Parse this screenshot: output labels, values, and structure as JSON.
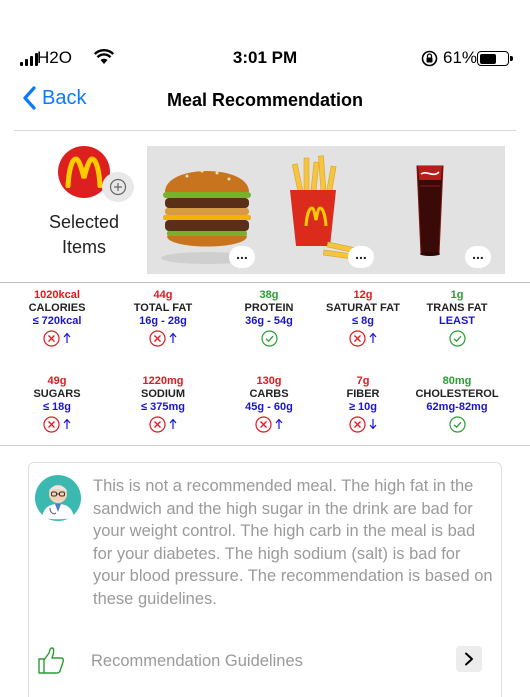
{
  "status_bar": {
    "carrier": "H2O",
    "time": "3:01 PM",
    "battery_percent": "61%",
    "battery_level": 0.61,
    "icons": [
      "signal-icon",
      "wifi-icon",
      "rotation-lock-icon",
      "battery-icon"
    ]
  },
  "nav": {
    "back_label": "Back",
    "title": "Meal Recommendation"
  },
  "selection": {
    "label": "Selected Items",
    "icons": [
      "mcdonalds-logo-icon",
      "add-item-icon"
    ],
    "items": [
      {
        "name": "big-mac-burger",
        "more_label": "..."
      },
      {
        "name": "french-fries",
        "more_label": "..."
      },
      {
        "name": "coca-cola-drink",
        "more_label": "..."
      }
    ]
  },
  "nutrients": [
    {
      "value": "1020kcal",
      "name": "CALORIES",
      "range": "≤ 720kcal",
      "status": "bad",
      "direction": "up"
    },
    {
      "value": "44g",
      "name": "TOTAL FAT",
      "range": "16g - 28g",
      "status": "bad",
      "direction": "up"
    },
    {
      "value": "38g",
      "name": "PROTEIN",
      "range": "36g - 54g",
      "status": "ok",
      "direction": ""
    },
    {
      "value": "12g",
      "name": "SATURAT FAT",
      "range": "≤ 8g",
      "status": "bad",
      "direction": "up"
    },
    {
      "value": "1g",
      "name": "TRANS FAT",
      "range": "LEAST",
      "status": "ok",
      "direction": ""
    },
    {
      "value": "49g",
      "name": "SUGARS",
      "range": "≤ 18g",
      "status": "bad",
      "direction": "up"
    },
    {
      "value": "1220mg",
      "name": "SODIUM",
      "range": "≤ 375mg",
      "status": "bad",
      "direction": "up"
    },
    {
      "value": "130g",
      "name": "CARBS",
      "range": "45g - 60g",
      "status": "bad",
      "direction": "up"
    },
    {
      "value": "7g",
      "name": "FIBER",
      "range": "≥ 10g",
      "status": "bad",
      "direction": "down"
    },
    {
      "value": "80mg",
      "name": "CHOLESTEROL",
      "range": "62mg-82mg",
      "status": "ok",
      "direction": ""
    }
  ],
  "recommendation": {
    "text": "This is not a recommended meal. The high fat in the sandwich and the high sugar in the drink are bad for your weight control. The high carb in the meal is bad for your diabetes. The high sodium (salt) is bad for your blood pressure. The recommendation is based on these guidelines.",
    "guidelines_label": "Recommendation Guidelines",
    "icons": [
      "doctor-avatar-icon",
      "thumbs-up-icon",
      "chevron-right-icon"
    ]
  },
  "colors": {
    "accent": "#0a7aff",
    "bad": "#e3191f",
    "ok": "#2a9d33",
    "range": "#1a14d6"
  }
}
